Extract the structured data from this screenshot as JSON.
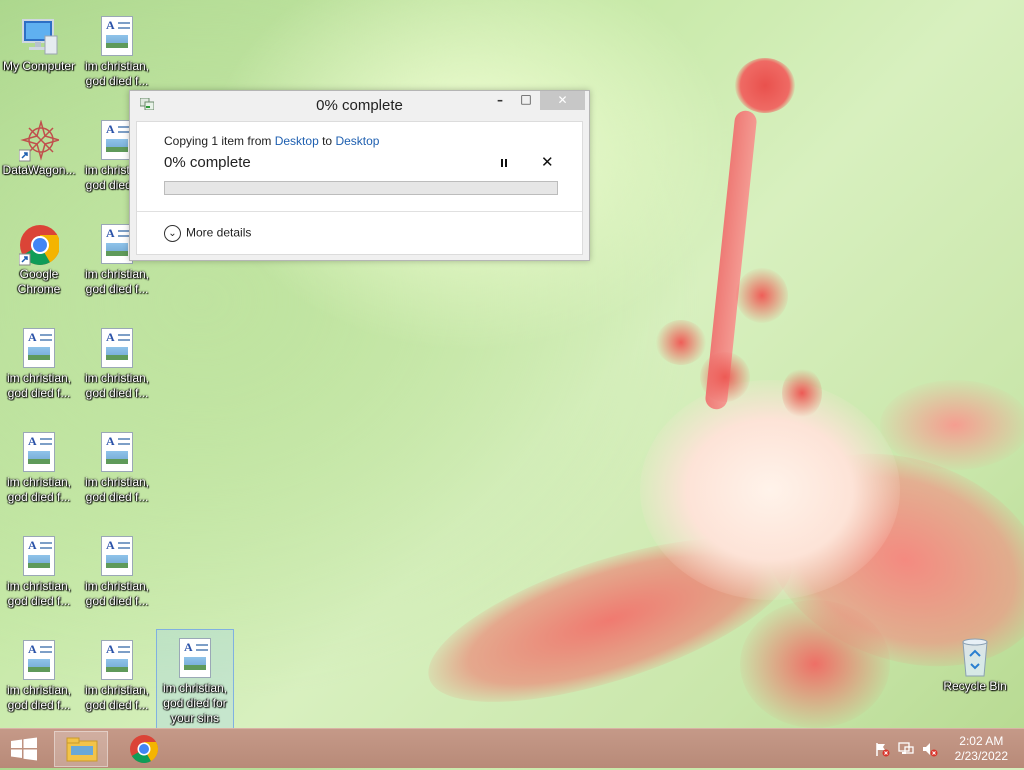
{
  "desktop": {
    "icons_col1": [
      {
        "label": "My Computer",
        "type": "computer"
      },
      {
        "label": "DataWagon...",
        "type": "datawagon"
      },
      {
        "label": "Google\nChrome",
        "type": "chrome"
      },
      {
        "label": "im christian,\ngod died f...",
        "type": "doc"
      },
      {
        "label": "im christian,\ngod died f...",
        "type": "doc"
      },
      {
        "label": "im christian,\ngod died f...",
        "type": "doc"
      },
      {
        "label": "im christian,\ngod died f...",
        "type": "doc"
      }
    ],
    "icons_col2": [
      {
        "label": "im christian,\ngod died f...",
        "type": "doc"
      },
      {
        "label": "im christian,\ngod died f...",
        "type": "doc"
      },
      {
        "label": "im christian,\ngod died f...",
        "type": "doc"
      },
      {
        "label": "im christian,\ngod died f...",
        "type": "doc"
      },
      {
        "label": "im christian,\ngod died f...",
        "type": "doc"
      },
      {
        "label": "im christian,\ngod died f...",
        "type": "doc"
      },
      {
        "label": "im christian,\ngod died f...",
        "type": "doc"
      }
    ],
    "selected_icon": {
      "label": "im christian,\ngod died for\nyour sins",
      "type": "doc"
    },
    "recycle_bin": {
      "label": "Recycle Bin",
      "icon": "recycle-bin-icon"
    }
  },
  "dialog": {
    "title": "0% complete",
    "copy_prefix": "Copying 1 item from ",
    "source": "Desktop",
    "copy_mid": " to ",
    "destination": "Desktop",
    "status": "0% complete",
    "progress": 0,
    "more_details": "More details",
    "minimize_glyph": "–",
    "maximize_glyph": "□",
    "close_glyph": "✕",
    "cancel_glyph": "✕"
  },
  "taskbar": {
    "start_icon": "windows-logo-icon",
    "pinned": [
      "file-explorer-icon",
      "chrome-icon"
    ],
    "tray_icons": [
      "action-center-flag-icon",
      "network-icon",
      "volume-muted-icon"
    ],
    "time": "2:02 AM",
    "date": "2/23/2022"
  }
}
